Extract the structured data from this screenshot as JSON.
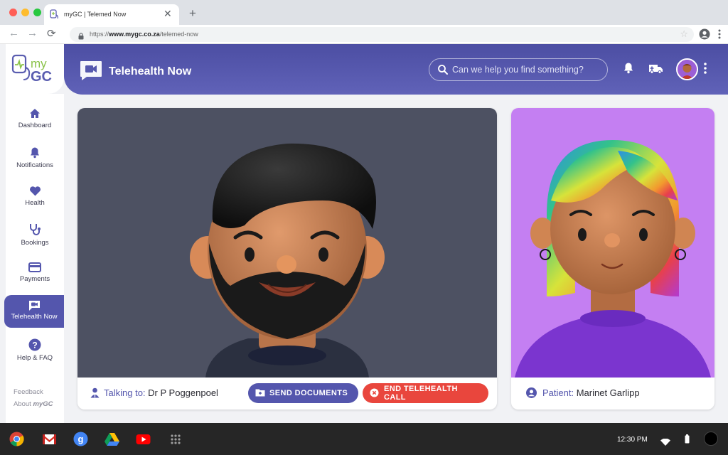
{
  "browser": {
    "tab_title": "myGC | Telemed Now",
    "url_prefix": "https://",
    "url_host": "www.mygc.co.za",
    "url_path": "/telemed-now"
  },
  "brand": {
    "logo_top": "my",
    "logo_bottom": "GC"
  },
  "header": {
    "title": "Telehealth Now",
    "search_placeholder": "Can we help you find something?"
  },
  "sidebar": {
    "items": [
      {
        "label": "Dashboard",
        "icon": "home-icon"
      },
      {
        "label": "Notifications",
        "icon": "bell-icon"
      },
      {
        "label": "Health",
        "icon": "heart-icon"
      },
      {
        "label": "Bookings",
        "icon": "stethoscope-icon"
      },
      {
        "label": "Payments",
        "icon": "credit-card-icon"
      },
      {
        "label": "Telehealth Now",
        "icon": "video-icon",
        "active": true
      },
      {
        "label": "Help & FAQ",
        "icon": "help-icon"
      }
    ],
    "feedback": "Feedback",
    "about_prefix": "About ",
    "about_brand": "myGC"
  },
  "call": {
    "talking_label": "Talking to:",
    "doctor_name": "Dr P Poggenpoel",
    "send_documents": "SEND DOCUMENTS",
    "end_call": "END TELEHEALTH CALL",
    "patient_label": "Patient:",
    "patient_name": "Marinet Garlipp"
  },
  "taskbar": {
    "apps": [
      "chrome-icon",
      "gmail-icon",
      "google-search-icon",
      "google-drive-icon",
      "youtube-icon",
      "app-launcher-icon"
    ],
    "clock": "12:30 PM"
  },
  "colors": {
    "primary": "#5456ad",
    "danger": "#e9463d",
    "doctor_bg": "#4d5162",
    "patient_bg": "#c47ff2"
  }
}
